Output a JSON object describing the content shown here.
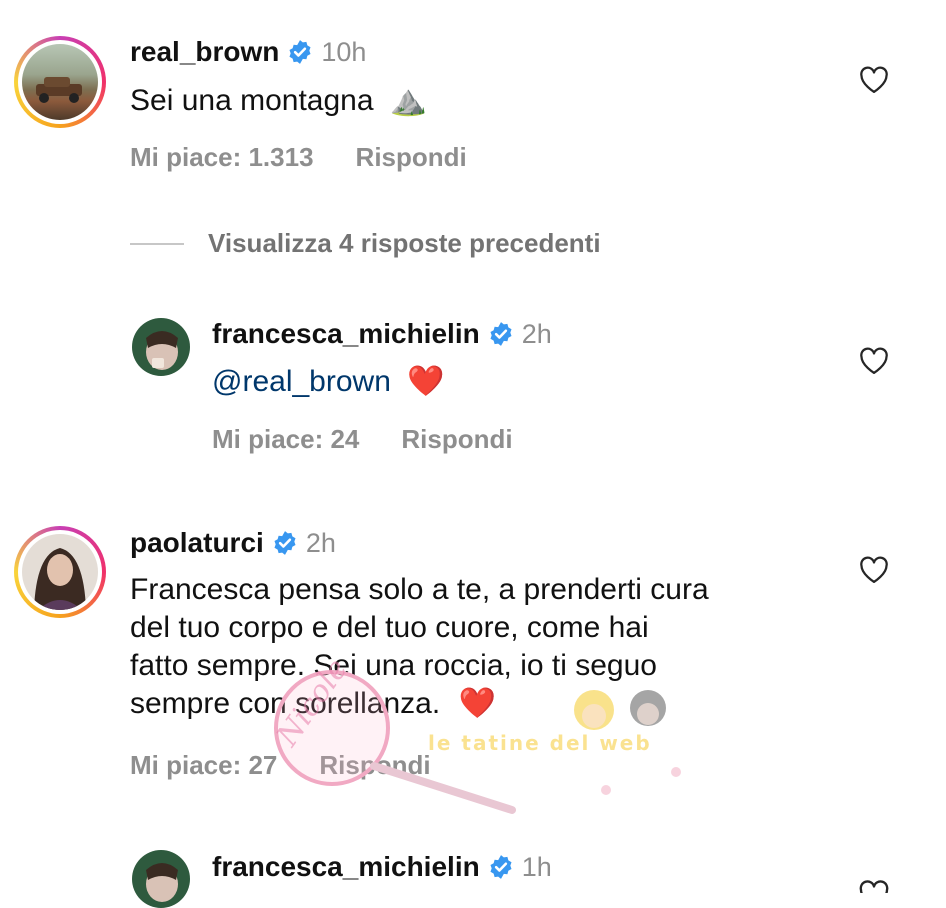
{
  "comments": [
    {
      "username": "real_brown",
      "time": "10h",
      "text": "Sei una montagna",
      "emoji": "⛰️",
      "likes_label": "Mi piace: 1.313",
      "reply_label": "Rispondi"
    },
    {
      "username": "francesca_michielin",
      "time": "2h",
      "mention": "@real_brown",
      "emoji": "❤️",
      "likes_label": "Mi piace: 24",
      "reply_label": "Rispondi"
    },
    {
      "username": "paolaturci",
      "time": "2h",
      "text_lines": [
        "Francesca pensa solo a te, a prenderti cura",
        "del tuo corpo e del tuo cuore, come hai",
        "fatto sempre. Sei una roccia, io ti seguo",
        "sempre con sorellanza."
      ],
      "emoji": "❤️",
      "likes_label": "Mi piace: 27",
      "reply_label": "Rispondi"
    },
    {
      "username": "francesca_michielin",
      "time": "1h"
    }
  ],
  "view_replies_label": "Visualizza 4 risposte precedenti",
  "watermark": {
    "left_text": "Nicole delle News",
    "right_text": "le tatine del web"
  },
  "colors": {
    "verified": "#3897f0",
    "mention": "#00376b",
    "meta": "#8e8e8e"
  },
  "icons": {
    "like": "heart-outline-icon",
    "verified": "verified-badge-icon"
  }
}
